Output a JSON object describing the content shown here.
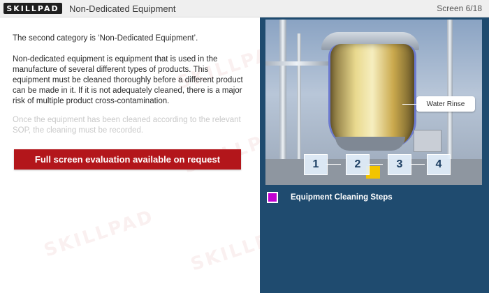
{
  "header": {
    "logo_text": "SKILLPAD",
    "title": "Non-Dedicated Equipment",
    "screen_counter": "Screen 6/18"
  },
  "content": {
    "paragraph1": "The second category is ‘Non-Dedicated Equipment’.",
    "paragraph2": "Non-dedicated equipment is equipment that is used in the manufacture of several different types of products. This equipment must be cleaned thoroughly before a different product can be made in it. If it is not adequately cleaned, there is a major risk of multiple product cross-contamination.",
    "paragraph3": "Once the equipment has been cleaned according to the relevant SOP, the cleaning must be recorded.",
    "evaluation_button": "Full screen evaluation available on request"
  },
  "media": {
    "callout_label": "Water Rinse",
    "steps": [
      "1",
      "2",
      "3",
      "4"
    ],
    "legend_label": "Equipment Cleaning Steps",
    "legend_color": "#c000d0"
  },
  "watermark_text": "SKILLPAD",
  "colors": {
    "header_bg": "#efefef",
    "panel_bg": "#1f4b6f",
    "button_bg": "#b3161b"
  }
}
